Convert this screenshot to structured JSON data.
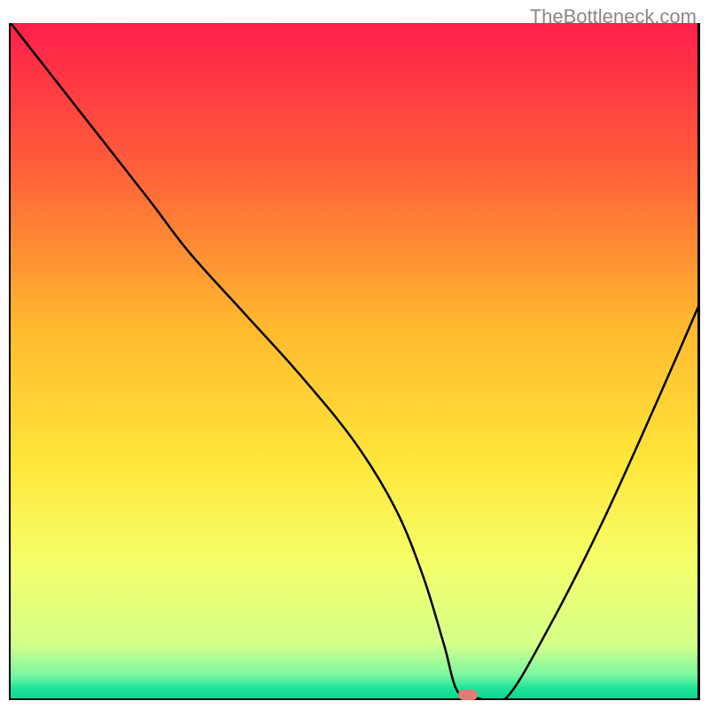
{
  "watermark": "TheBottleneck.com",
  "chart_data": {
    "type": "line",
    "title": "",
    "xlabel": "",
    "ylabel": "",
    "xlim": [
      0,
      100
    ],
    "ylim": [
      0,
      100
    ],
    "gradient_stops": [
      {
        "offset": 0.0,
        "color": "#ff1f4b"
      },
      {
        "offset": 0.2,
        "color": "#ff5a3a"
      },
      {
        "offset": 0.45,
        "color": "#ffb92e"
      },
      {
        "offset": 0.65,
        "color": "#ffe63a"
      },
      {
        "offset": 0.8,
        "color": "#f5ff6a"
      },
      {
        "offset": 0.92,
        "color": "#d4ff8a"
      },
      {
        "offset": 0.965,
        "color": "#7cf7a0"
      },
      {
        "offset": 0.985,
        "color": "#1ee49a"
      },
      {
        "offset": 1.0,
        "color": "#12d68e"
      }
    ],
    "series": [
      {
        "name": "bottleneck-curve",
        "x": [
          0,
          10,
          20,
          26,
          34,
          42,
          50,
          56,
          60,
          63,
          65,
          68,
          72,
          78,
          86,
          94,
          100
        ],
        "y": [
          100,
          87,
          74,
          66,
          57,
          48,
          38,
          28,
          18,
          8,
          1,
          0,
          0,
          10,
          26,
          44,
          58
        ]
      }
    ],
    "marker": {
      "x": 66.5,
      "y": 0.5,
      "color": "#e27a76"
    }
  }
}
